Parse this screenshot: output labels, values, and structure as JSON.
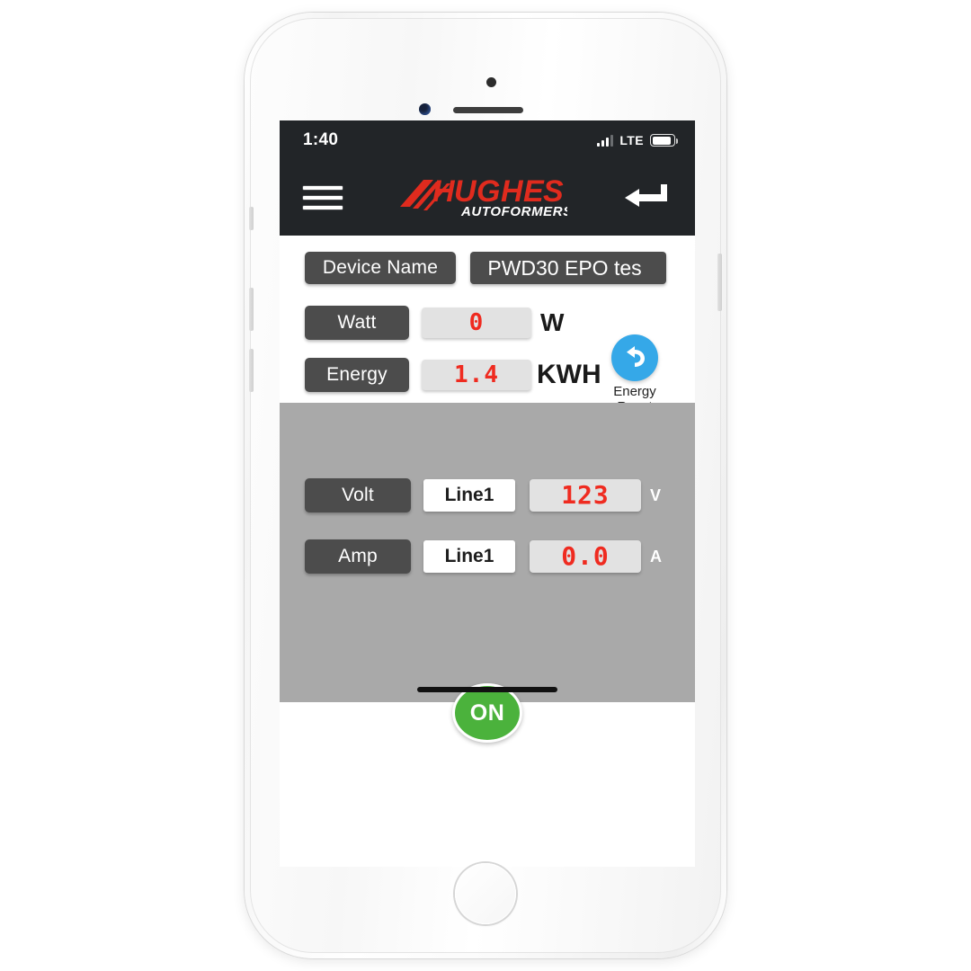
{
  "statusbar": {
    "time": "1:40",
    "network_label": "LTE",
    "signal_icon": "signal-bars-icon",
    "battery_icon": "battery-full-icon"
  },
  "navbar": {
    "menu_icon": "hamburger-menu-icon",
    "back_icon": "return-arrow-icon",
    "logo": {
      "primary": "HUGHES",
      "secondary": "AUTOFORMERS",
      "primary_color": "#e02b1e",
      "secondary_color": "#ffffff"
    },
    "background_color": "#222528"
  },
  "device": {
    "name_label": "Device Name",
    "name_value": "PWD30 EPO tes"
  },
  "readings": {
    "watt": {
      "label": "Watt",
      "value": "0",
      "unit": "W"
    },
    "energy": {
      "label": "Energy",
      "value": "1.4",
      "unit": "KWH"
    },
    "volt": {
      "label": "Volt",
      "line": "Line1",
      "value": "123",
      "unit": "V"
    },
    "amp": {
      "label": "Amp",
      "line": "Line1",
      "value": "0.0",
      "unit": "A"
    }
  },
  "energy_reset": {
    "icon": "undo-arrow-icon",
    "line1": "Energy",
    "line2": "Reset",
    "color": "#35a8e8"
  },
  "power_toggle": {
    "label": "ON",
    "state": "on",
    "color": "#4bb23c"
  },
  "colors": {
    "lcd_digit": "#ef2b20",
    "lcd_background": "#e2e2e2",
    "label_chip": "#4c4c4c",
    "panel_gray": "#a9a9a9",
    "panel_white": "#ffffff"
  }
}
